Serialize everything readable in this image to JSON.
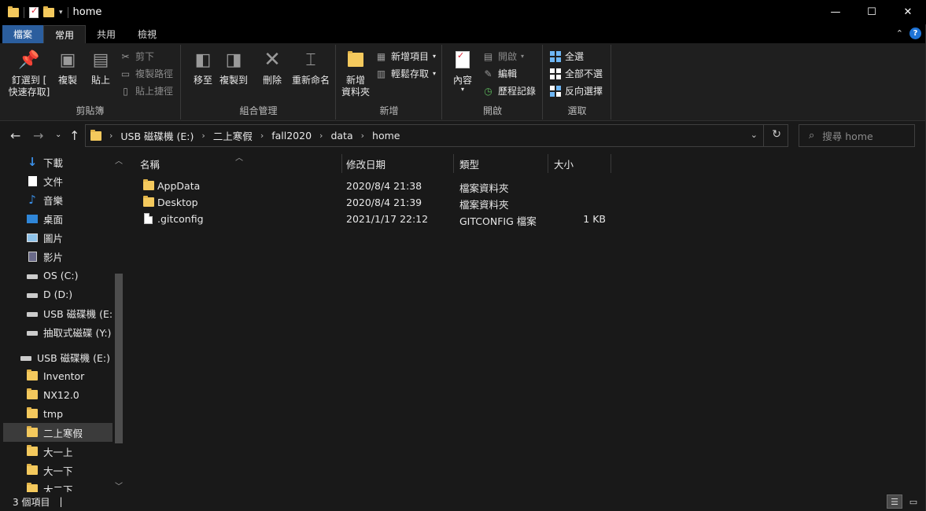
{
  "window": {
    "title": "home",
    "controls": {
      "minimize": "—",
      "maximize": "☐",
      "close": "✕"
    }
  },
  "ribbon_tabs": [
    "檔案",
    "常用",
    "共用",
    "檢視"
  ],
  "ribbon": {
    "clipboard": {
      "label": "剪貼簿",
      "pin": "釘選到 [\n快速存取]",
      "pin_l1": "釘選到 [",
      "pin_l2": "快速存取]",
      "copy": "複製",
      "paste": "貼上",
      "cut": "剪下",
      "copy_path": "複製路徑",
      "paste_shortcut": "貼上捷徑"
    },
    "organize": {
      "label": "組合管理",
      "move_to": "移至",
      "copy_to": "複製到",
      "delete": "刪除",
      "rename": "重新命名"
    },
    "new": {
      "label": "新增",
      "new_folder_l1": "新增",
      "new_folder_l2": "資料夾",
      "new_item": "新增項目",
      "easy_access": "輕鬆存取"
    },
    "open": {
      "label": "開啟",
      "properties": "內容",
      "open": "開啟",
      "edit": "編輯",
      "history": "歷程記錄"
    },
    "select": {
      "label": "選取",
      "select_all": "全選",
      "select_none": "全部不選",
      "invert": "反向選擇"
    }
  },
  "address": {
    "crumbs": [
      "USB 磁碟機 (E:)",
      "二上寒假",
      "fall2020",
      "data",
      "home"
    ]
  },
  "search": {
    "placeholder": "搜尋 home"
  },
  "sidebar": {
    "items": [
      {
        "label": "下載",
        "icon": "download-icon"
      },
      {
        "label": "文件",
        "icon": "document-icon"
      },
      {
        "label": "音樂",
        "icon": "music-icon"
      },
      {
        "label": "桌面",
        "icon": "desktop-icon"
      },
      {
        "label": "圖片",
        "icon": "pictures-icon"
      },
      {
        "label": "影片",
        "icon": "video-icon"
      },
      {
        "label": "OS (C:)",
        "icon": "drive-icon"
      },
      {
        "label": "D (D:)",
        "icon": "drive-icon"
      },
      {
        "label": "USB 磁碟機 (E:)",
        "icon": "drive-icon"
      },
      {
        "label": "抽取式磁碟 (Y:)",
        "icon": "drive-icon"
      },
      {
        "label": "USB 磁碟機 (E:)",
        "icon": "drive-icon"
      },
      {
        "label": "Inventor",
        "icon": "folder-icon"
      },
      {
        "label": "NX12.0",
        "icon": "folder-icon"
      },
      {
        "label": "tmp",
        "icon": "folder-icon"
      },
      {
        "label": "二上寒假",
        "icon": "folder-icon"
      },
      {
        "label": "大一上",
        "icon": "folder-icon"
      },
      {
        "label": "大一下",
        "icon": "folder-icon"
      },
      {
        "label": "大二下",
        "icon": "folder-icon"
      }
    ]
  },
  "columns": [
    "名稱",
    "修改日期",
    "類型",
    "大小"
  ],
  "files": [
    {
      "name": "AppData",
      "date": "2020/8/4 21:38",
      "type": "檔案資料夾",
      "size": ""
    },
    {
      "name": "Desktop",
      "date": "2020/8/4 21:39",
      "type": "檔案資料夾",
      "size": ""
    },
    {
      "name": ".gitconfig",
      "date": "2021/1/17 22:12",
      "type": "GITCONFIG 檔案",
      "size": "1 KB"
    }
  ],
  "status": {
    "count": "3 個項目",
    "cursor": "|"
  },
  "colors": {
    "file_tab": "#2b5e9e",
    "folder": "#f4c95d",
    "selected": "#3b3b3b"
  }
}
